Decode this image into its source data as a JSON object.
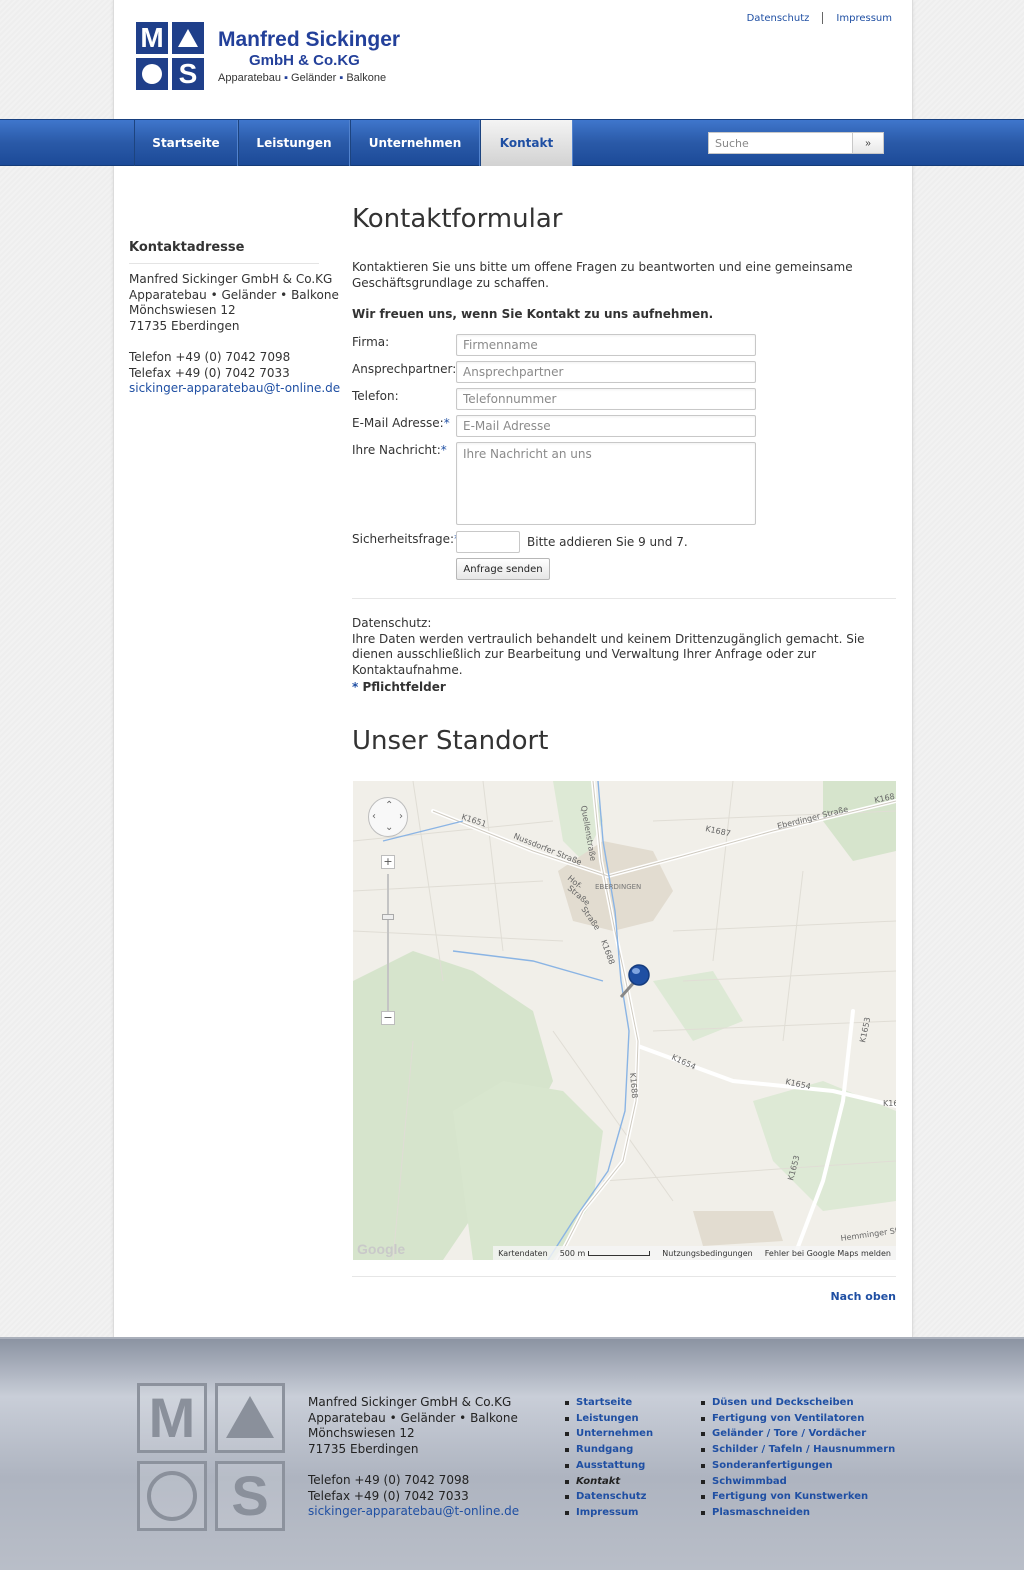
{
  "header": {
    "brand_line1": "Manfred Sickinger",
    "brand_line2": "GmbH & Co.KG",
    "brand_parts": [
      "Apparatebau",
      "Geländer",
      "Balkone"
    ],
    "logo_letters": [
      "M",
      "S"
    ],
    "toplinks": [
      "Datenschutz",
      "Impressum"
    ]
  },
  "nav": {
    "items": [
      "Startseite",
      "Leistungen",
      "Unternehmen",
      "Kontakt"
    ],
    "active_index": 3,
    "search_placeholder": "Suche",
    "search_button": "»"
  },
  "sidebar": {
    "title": "Kontaktadresse",
    "address": [
      "Manfred Sickinger GmbH & Co.KG",
      "Apparatebau • Geländer • Balkone",
      "Mönchswiesen 12",
      "71735 Eberdingen"
    ],
    "phone": "Telefon +49 (0) 7042 7098",
    "fax": "Telefax +49 (0) 7042 7033",
    "email": "sickinger-apparatebau@t-online.de"
  },
  "main": {
    "title": "Kontaktformular",
    "intro": "Kontaktieren Sie uns bitte um offene Fragen zu beantworten und eine gemeinsame Geschäftsgrundlage zu schaffen.",
    "lead": "Wir freuen uns, wenn Sie Kontakt zu uns aufnehmen.",
    "form": {
      "firma_label": "Firma:",
      "firma_placeholder": "Firmenname",
      "ansprech_label": "Ansprechpartner:",
      "ansprech_placeholder": "Ansprechpartner",
      "telefon_label": "Telefon:",
      "telefon_placeholder": "Telefonnummer",
      "email_label": "E-Mail Adresse:",
      "email_placeholder": "E-Mail Adresse",
      "message_label": "Ihre Nachricht:",
      "message_placeholder": "Ihre Nachricht an uns",
      "security_label": "Sicherheitsfrage:",
      "security_hint": "Bitte addieren Sie 9 und 7.",
      "submit": "Anfrage senden",
      "required_mark": "*"
    },
    "privacy_title": "Datenschutz:",
    "privacy_text": "Ihre Daten werden vertraulich behandelt und keinem Drittenzugänglich gemacht. Sie dienen ausschließlich zur Bearbeitung und Verwaltung Ihrer Anfrage oder zur Kontaktaufnahme.",
    "required_note": "Pflichtfelder",
    "location_title": "Unser Standort",
    "back_to_top": "Nach oben"
  },
  "map": {
    "labels": {
      "town": "EBERDINGEN",
      "k1651": "K1651",
      "nussdorfer": "Nussdorfer Straße",
      "quellen": "Quellenstraße",
      "k1687": "K1687",
      "eberdinger": "Eberdinger Straße",
      "k168_top": "K168",
      "k1688_a": "K1688",
      "k1688_b": "K1688",
      "k1654_a": "K1654",
      "k1654_b": "K1654",
      "k1653_a": "K1653",
      "k1653_b": "K1653",
      "k16": "K16",
      "hemminger": "Hemminger St",
      "hof": "Hof-",
      "strasse": "Straße",
      "strasse2": "Straße"
    },
    "google": "Google",
    "attrib": [
      "Kartendaten",
      "500 m",
      "Nutzungsbedingungen",
      "Fehler bei Google Maps melden"
    ],
    "zoom_plus": "+",
    "zoom_minus": "−"
  },
  "footer": {
    "address": [
      "Manfred Sickinger GmbH & Co.KG",
      "Apparatebau • Geländer • Balkone",
      "Mönchswiesen 12",
      "71735 Eberdingen"
    ],
    "phone": "Telefon +49 (0) 7042 7098",
    "fax": "Telefax +49 (0) 7042 7033",
    "email": "sickinger-apparatebau@t-online.de",
    "logo_letters": [
      "M",
      "S"
    ],
    "links_col1": [
      "Startseite",
      "Leistungen",
      "Unternehmen",
      "Rundgang",
      "Ausstattung",
      "Kontakt",
      "Datenschutz",
      "Impressum"
    ],
    "links_col2": [
      "Düsen und Deckscheiben",
      "Fertigung von Ventilatoren",
      "Geländer / Tore / Vordächer",
      "Schilder / Tafeln / Hausnummern",
      "Sonderanfertigungen",
      "Schwimmbad",
      "Fertigung von Kunstwerken",
      "Plasmaschneiden"
    ]
  },
  "colors": {
    "brand_blue": "#23409a",
    "nav_blue": "#2a5aa8",
    "link_blue": "#1f4fa3"
  }
}
